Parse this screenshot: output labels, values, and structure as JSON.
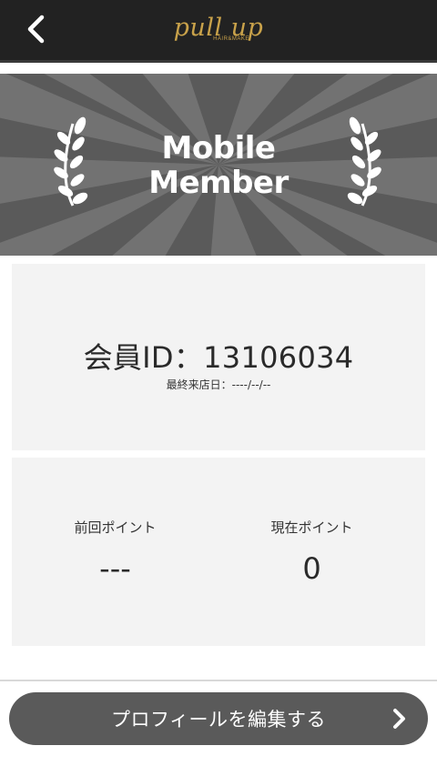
{
  "header": {
    "logo_main": "pull up",
    "logo_sub": "HAIR&MAKE"
  },
  "banner": {
    "title_line1": "Mobile",
    "title_line2": "Member"
  },
  "member": {
    "id_text": "会員ID：13106034",
    "last_visit": "最終来店日：----/--/--"
  },
  "points": {
    "previous_label": "前回ポイント",
    "previous_value": "---",
    "current_label": "現在ポイント",
    "current_value": "0"
  },
  "actions": {
    "edit_profile_label": "プロフィールを編集する"
  },
  "colors": {
    "header_bg": "#222222",
    "logo_gold": "#c9a24a",
    "banner_bg": "#5a5a5a",
    "card_bg": "#f3f3f3",
    "button_bg": "#5a5a5a"
  },
  "icons": {
    "back": "chevron-left-icon",
    "laurel": "laurel-icon",
    "forward": "chevron-right-icon"
  }
}
